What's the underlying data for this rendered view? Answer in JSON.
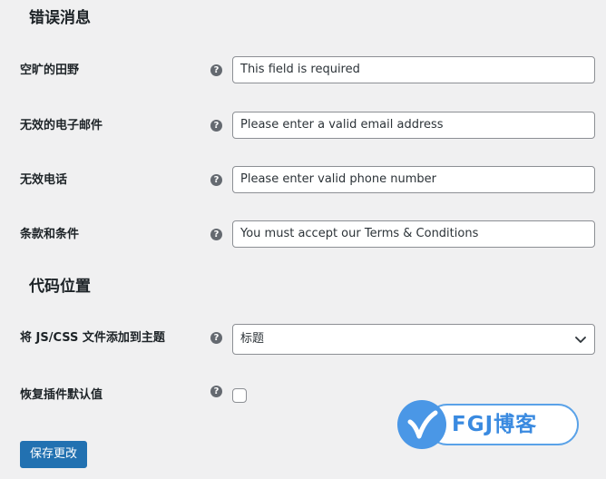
{
  "error_messages": {
    "heading": "错误消息",
    "fields": [
      {
        "label": "空旷的田野",
        "value": "This field is required"
      },
      {
        "label": "无效的电子邮件",
        "value": "Please enter a valid email address"
      },
      {
        "label": "无效电话",
        "value": "Please enter valid phone number"
      },
      {
        "label": "条款和条件",
        "value": "You must accept our Terms & Conditions"
      }
    ]
  },
  "code_location": {
    "heading": "代码位置",
    "js_css_label": "将 JS/CSS 文件添加到主题",
    "js_css_selected": "标题",
    "reset_label": "恢复插件默认值",
    "reset_checked": false
  },
  "help_icon_glyph": "?",
  "icons": {
    "help": "question-circle-icon",
    "select_arrow": "chevron-down-icon"
  },
  "save_button": "保存更改",
  "watermark": {
    "text": "FGJ博客"
  },
  "colors": {
    "background": "#f0f0f1",
    "primary_button": "#2271b1",
    "input_border": "#8c8f94",
    "help_icon": "#646970"
  }
}
